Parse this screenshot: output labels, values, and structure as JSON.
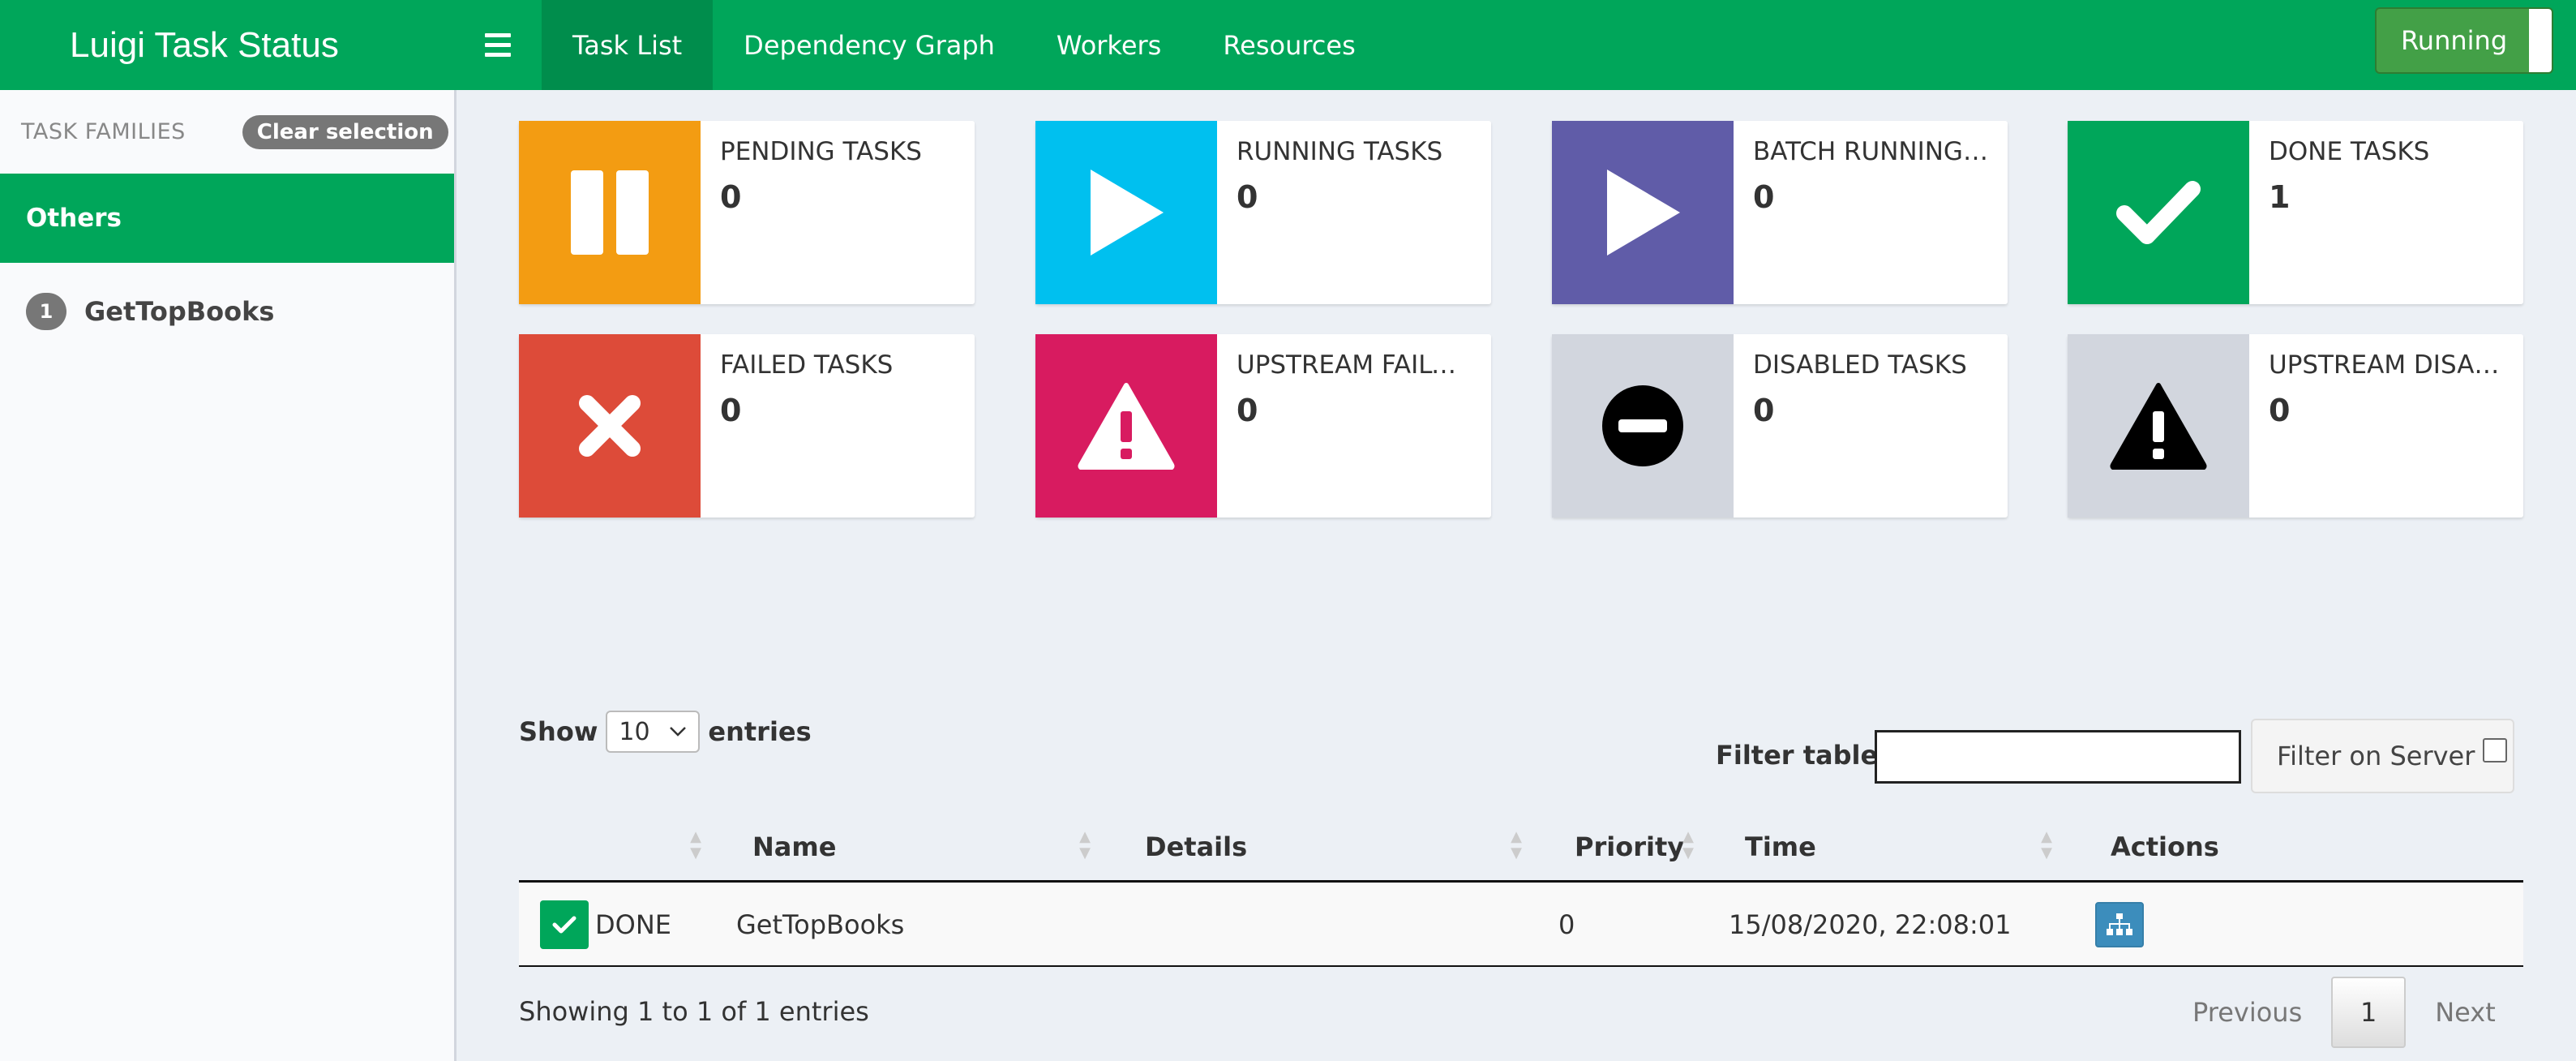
{
  "navbar": {
    "brand": "Luigi Task Status",
    "tabs": [
      {
        "label": "Task List",
        "active": true
      },
      {
        "label": "Dependency Graph",
        "active": false
      },
      {
        "label": "Workers",
        "active": false
      },
      {
        "label": "Resources",
        "active": false
      }
    ],
    "toggle_label": "Running"
  },
  "sidebar": {
    "title": "TASK FAMILIES",
    "clear_label": "Clear selection",
    "group_label": "Others",
    "families": [
      {
        "count": "1",
        "name": "GetTopBooks"
      }
    ]
  },
  "info_boxes": [
    {
      "label": "PENDING TASKS",
      "value": "0",
      "color": "#f39c12",
      "icon": "pause-icon"
    },
    {
      "label": "RUNNING TASKS",
      "value": "0",
      "color": "#00c0ef",
      "icon": "play-icon"
    },
    {
      "label": "BATCH RUNNING TASKS",
      "value": "0",
      "color": "#605ca8",
      "icon": "play-icon"
    },
    {
      "label": "DONE TASKS",
      "value": "1",
      "color": "#00a65a",
      "icon": "check-icon"
    },
    {
      "label": "FAILED TASKS",
      "value": "0",
      "color": "#dd4b39",
      "icon": "times-icon"
    },
    {
      "label": "UPSTREAM FAILURE",
      "value": "0",
      "color": "#d81b60",
      "icon": "warning-icon"
    },
    {
      "label": "DISABLED TASKS",
      "value": "0",
      "color": "#d2d6de",
      "icon": "minus-circle-icon"
    },
    {
      "label": "UPSTREAM DISABLED",
      "value": "0",
      "color": "#d2d6de",
      "icon": "warning-icon"
    }
  ],
  "table_controls": {
    "show_label": "Show",
    "entries_label": "entries",
    "page_length": "10",
    "filter_label": "Filter table:",
    "filter_value": "",
    "filter_server_label": "Filter on Server"
  },
  "table": {
    "columns": [
      "",
      "Name",
      "Details",
      "Priority",
      "Time",
      "Actions"
    ],
    "rows": [
      {
        "status": "DONE",
        "name": "GetTopBooks",
        "details": "",
        "priority": "0",
        "time": "15/08/2020, 22:08:01"
      }
    ]
  },
  "footer": {
    "info": "Showing 1 to 1 of 1 entries",
    "previous": "Previous",
    "page": "1",
    "next": "Next"
  }
}
